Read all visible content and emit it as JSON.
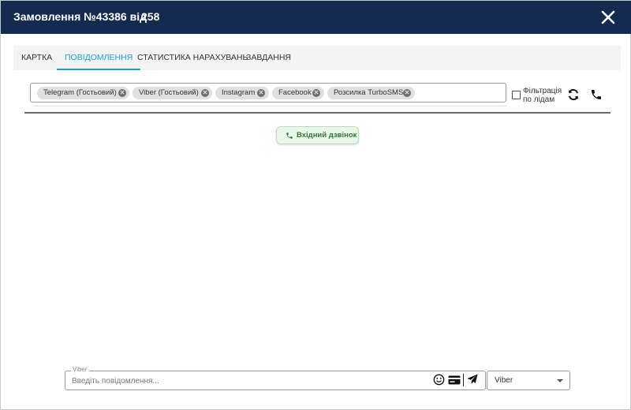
{
  "header": {
    "title": "Замовлення №43386 від",
    "number": "258"
  },
  "tabs": [
    {
      "label": "КАРТКА",
      "active": false
    },
    {
      "label": "ПОВІДОМЛЕННЯ",
      "active": true
    },
    {
      "label": "СТАТИСТИКА НАРАХУВАНЬ",
      "active": false
    },
    {
      "label": "ЗАВДАННЯ",
      "active": false
    }
  ],
  "channels_filter": {
    "chips": [
      "Telegram (Гостьовий)",
      "Viber (Гостьовий)",
      "Instagram",
      "Facebook",
      "Розсилка TurboSMS"
    ],
    "lead_filter_label_line1": "Фільтрація",
    "lead_filter_label_line2": "по лідам",
    "lead_filter_checked": false
  },
  "messages": [
    {
      "type": "incoming-call",
      "text": "Вхідний дзвінок"
    }
  ],
  "composer": {
    "legend": "Viber",
    "placeholder": "Введіть повідомлення...",
    "value": "",
    "channel_selected": "Viber"
  },
  "colors": {
    "header_bg": "#152a4f",
    "accent": "#1a9fd8",
    "call_green": "#2e7d32"
  },
  "icons": [
    "close-icon",
    "remove-chip-icon",
    "refresh-icon",
    "phone-icon",
    "emoji-icon",
    "card-icon",
    "send-icon",
    "chevron-down-icon"
  ]
}
